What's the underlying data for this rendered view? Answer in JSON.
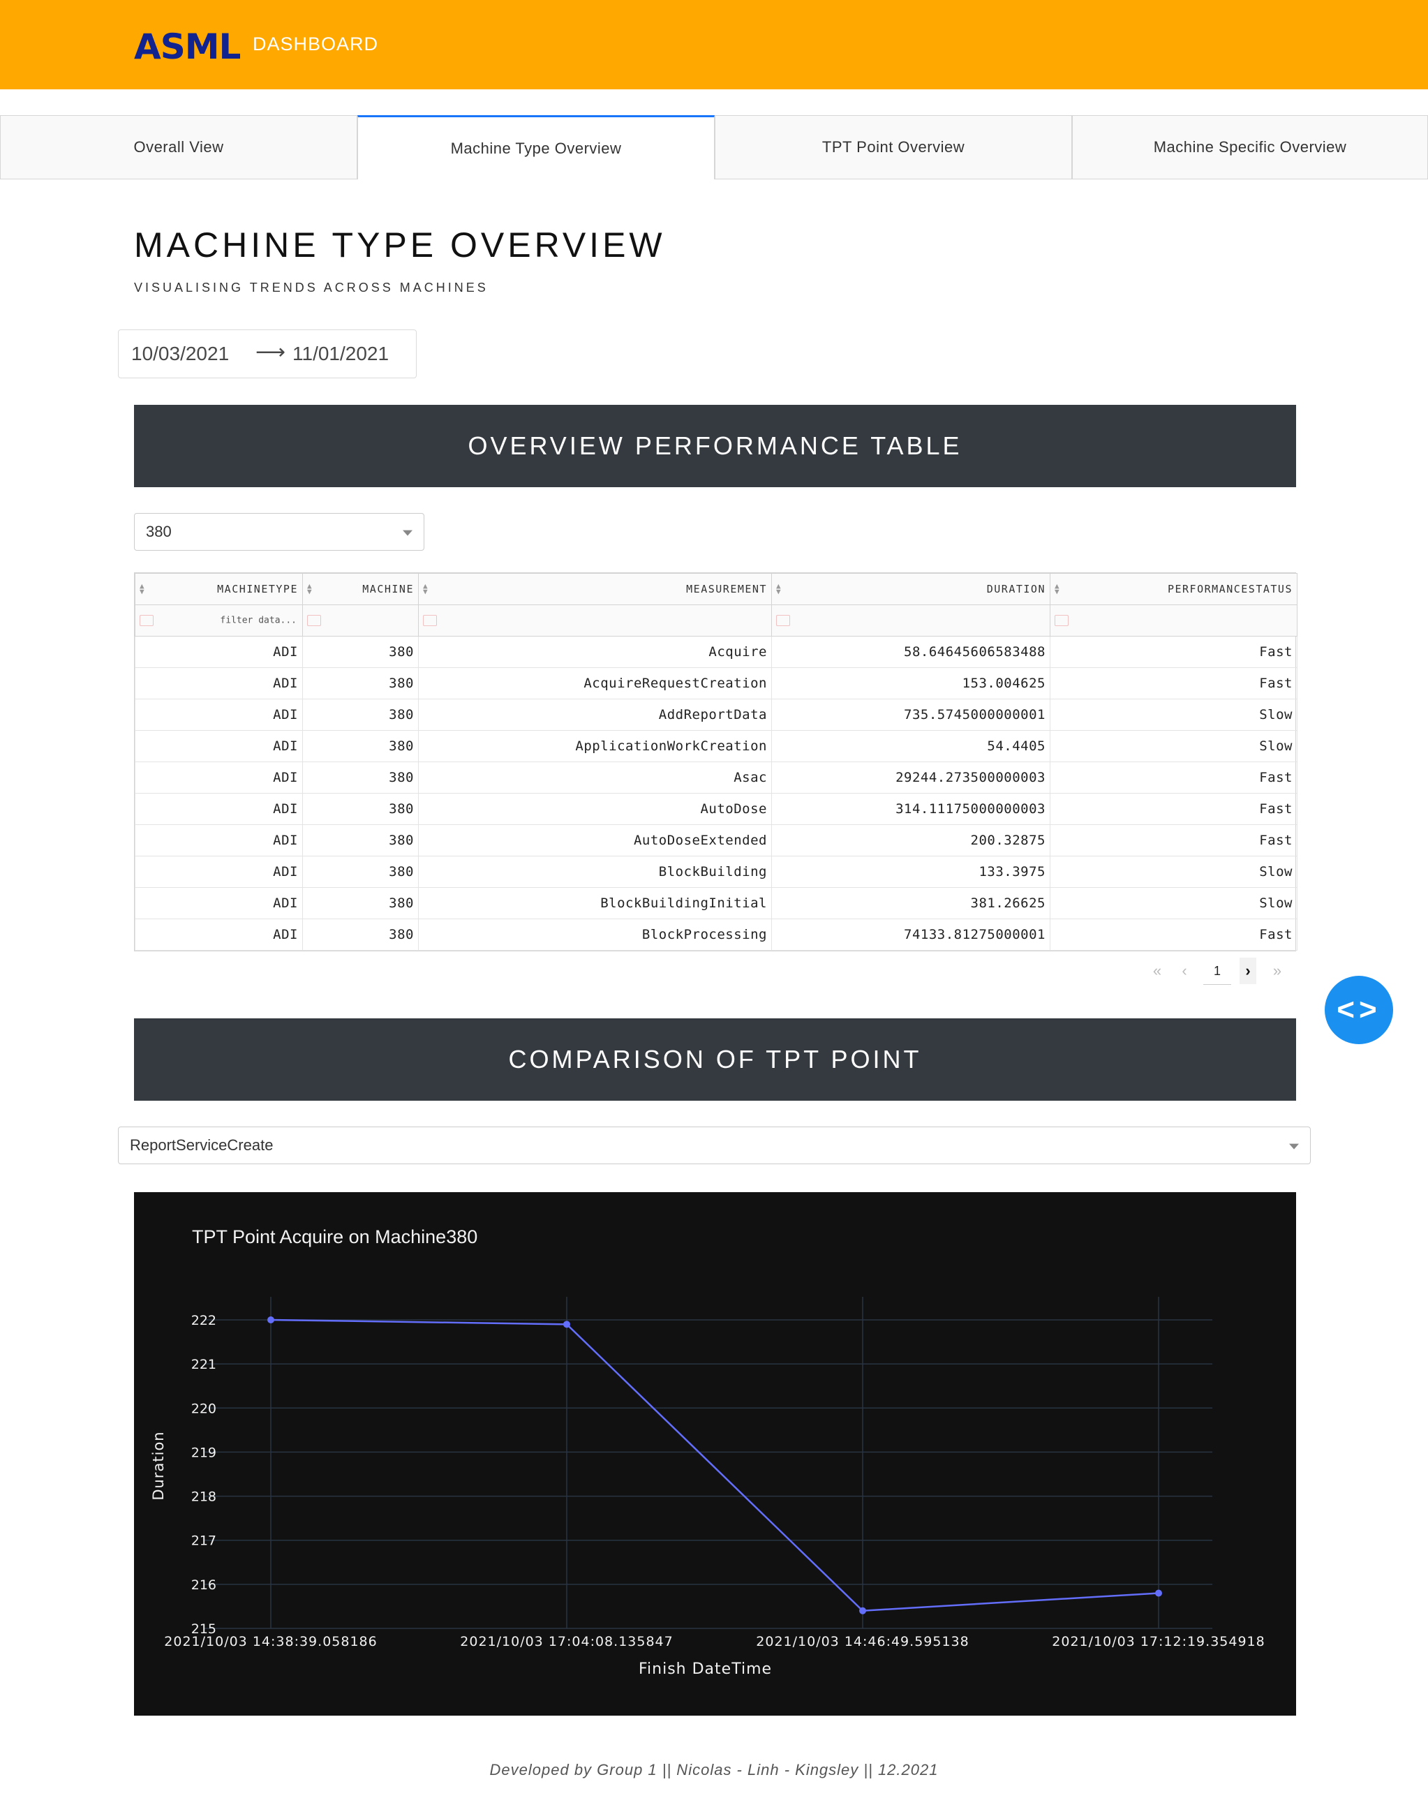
{
  "header": {
    "logo": "ASML",
    "label": "DASHBOARD",
    "brand_color": "#ffa800",
    "logo_color": "#10238e"
  },
  "tabs": [
    {
      "label": "Overall View"
    },
    {
      "label": "Machine Type Overview",
      "active": true
    },
    {
      "label": "TPT Point Overview"
    },
    {
      "label": "Machine Specific Overview"
    }
  ],
  "page": {
    "title": "MACHINE TYPE OVERVIEW",
    "subtitle": "VISUALISING TRENDS ACROSS MACHINES"
  },
  "daterange": {
    "start": "10/03/2021",
    "arrow": "⟶",
    "end": "11/01/2021"
  },
  "performance": {
    "header": "OVERVIEW PERFORMANCE TABLE",
    "machine_select": "380",
    "columns": [
      "MACHINETYPE",
      "MACHINE",
      "MEASUREMENT",
      "DURATION",
      "PERFORMANCESTATUS"
    ],
    "filter_placeholder": "filter data...",
    "rows": [
      [
        "ADI",
        "380",
        "Acquire",
        "58.64645606583488",
        "Fast"
      ],
      [
        "ADI",
        "380",
        "AcquireRequestCreation",
        "153.004625",
        "Fast"
      ],
      [
        "ADI",
        "380",
        "AddReportData",
        "735.5745000000001",
        "Slow"
      ],
      [
        "ADI",
        "380",
        "ApplicationWorkCreation",
        "54.4405",
        "Slow"
      ],
      [
        "ADI",
        "380",
        "Asac",
        "29244.273500000003",
        "Fast"
      ],
      [
        "ADI",
        "380",
        "AutoDose",
        "314.11175000000003",
        "Fast"
      ],
      [
        "ADI",
        "380",
        "AutoDoseExtended",
        "200.32875",
        "Fast"
      ],
      [
        "ADI",
        "380",
        "BlockBuilding",
        "133.3975",
        "Slow"
      ],
      [
        "ADI",
        "380",
        "BlockBuildingInitial",
        "381.26625",
        "Slow"
      ],
      [
        "ADI",
        "380",
        "BlockProcessing",
        "74133.81275000001",
        "Fast"
      ]
    ],
    "pager": {
      "first": "«",
      "prev": "‹",
      "page": "1",
      "next": "›",
      "last": "»"
    }
  },
  "comparison": {
    "header": "COMPARISON OF TPT POINT",
    "tpt_select": "ReportServiceCreate"
  },
  "fab_icon": "code-brackets-icon",
  "chart_data": {
    "type": "line",
    "title": "TPT Point Acquire on Machine380",
    "xlabel": "Finish DateTime",
    "ylabel": "Duration",
    "categories": [
      "2021/10/03 14:38:39.058186",
      "2021/10/03 17:04:08.135847",
      "2021/10/03 14:46:49.595138",
      "2021/10/03 17:12:19.354918"
    ],
    "series": [
      {
        "values": [
          222.0,
          221.9,
          215.4,
          215.8
        ],
        "color": "#636efa"
      }
    ],
    "ylim": [
      215,
      222
    ],
    "yticks": [
      "215",
      "216",
      "217",
      "218",
      "219",
      "220",
      "221",
      "222"
    ],
    "grid": true,
    "background": "#111111"
  },
  "footer": "Developed by Group 1 || Nicolas - Linh - Kingsley || 12.2021"
}
